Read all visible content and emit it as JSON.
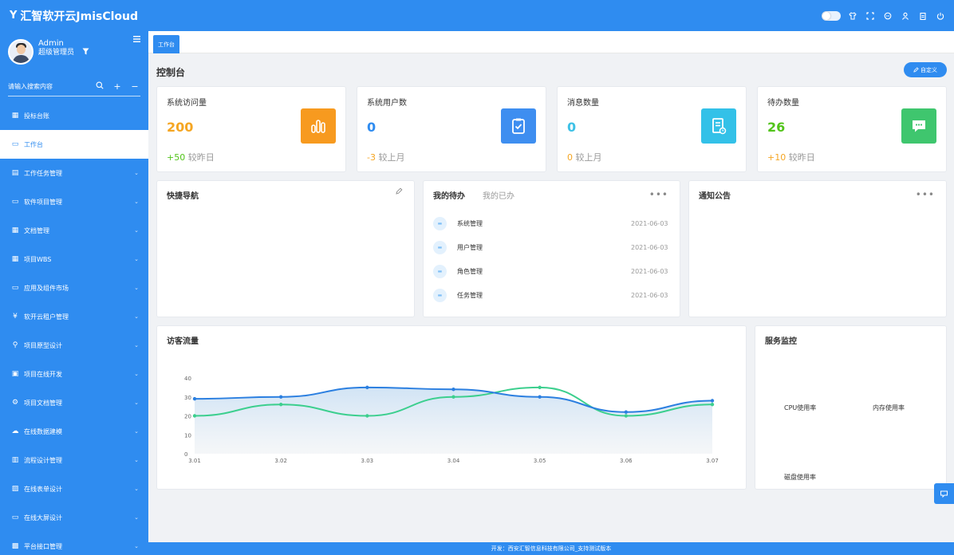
{
  "header": {
    "brand_mark": "Y",
    "brand_name": "汇智软开云JmisCloud",
    "icons": [
      "theme-toggle",
      "shirt-icon",
      "fullscreen-icon",
      "chat-icon",
      "user-icon",
      "clipboard-icon",
      "power-icon"
    ]
  },
  "sidebar": {
    "user_name": "Admin",
    "user_role": "超级管理员",
    "search_placeholder": "请输入搜索内容",
    "items": [
      {
        "label": "投标台账",
        "icon": "grid-icon",
        "chevron": false
      },
      {
        "label": "工作台",
        "icon": "monitor-icon",
        "chevron": false,
        "active": true
      },
      {
        "label": "工作任务管理",
        "icon": "clipboard-icon",
        "chevron": true
      },
      {
        "label": "软件项目管理",
        "icon": "monitor-icon",
        "chevron": true
      },
      {
        "label": "文档管理",
        "icon": "grid-icon",
        "chevron": true
      },
      {
        "label": "项目WBS",
        "icon": "grid-icon",
        "chevron": true
      },
      {
        "label": "应用及组件市场",
        "icon": "monitor-icon",
        "chevron": true
      },
      {
        "label": "软开云租户管理",
        "icon": "yen-icon",
        "chevron": true
      },
      {
        "label": "项目原型设计",
        "icon": "link-icon",
        "chevron": true
      },
      {
        "label": "项目在线开发",
        "icon": "doc-icon",
        "chevron": true
      },
      {
        "label": "项目文档管理",
        "icon": "settings-icon",
        "chevron": true
      },
      {
        "label": "在线数据建模",
        "icon": "cloud-icon",
        "chevron": true
      },
      {
        "label": "流程设计管理",
        "icon": "flow-icon",
        "chevron": true
      },
      {
        "label": "在线表单设计",
        "icon": "form-icon",
        "chevron": true
      },
      {
        "label": "在线大屏设计",
        "icon": "screen-icon",
        "chevron": true
      },
      {
        "label": "平台接口管理",
        "icon": "api-icon",
        "chevron": true
      }
    ]
  },
  "tabs": [
    {
      "label": "工作台"
    }
  ],
  "main": {
    "title": "控制台",
    "custom_button": "自定义"
  },
  "stats": [
    {
      "label": "系统访问量",
      "value": "200",
      "value_color": "#f5a623",
      "delta": "+50",
      "delta_color": "#52c41a",
      "delta_text": "较昨日",
      "icon": "bar-chart-icon",
      "icon_bg": "#f79a1f"
    },
    {
      "label": "系统用户数",
      "value": "0",
      "value_color": "#2f8cf0",
      "delta": "-3",
      "delta_color": "#f5a623",
      "delta_text": "较上月",
      "icon": "check-list-icon",
      "icon_bg": "#3e8ef0"
    },
    {
      "label": "消息数量",
      "value": "0",
      "value_color": "#3ec1e6",
      "delta": "0",
      "delta_color": "#f5a623",
      "delta_text": "较上月",
      "icon": "message-doc-icon",
      "icon_bg": "#33c1e8"
    },
    {
      "label": "待办数量",
      "value": "26",
      "value_color": "#52c41a",
      "delta": "+10",
      "delta_color": "#f5a623",
      "delta_text": "较昨日",
      "icon": "chat-bubble-icon",
      "icon_bg": "#3fc66e"
    }
  ],
  "quick_nav": {
    "title": "快捷导航"
  },
  "todo": {
    "tab_active": "我的待办",
    "tab_other": "我的已办",
    "items": [
      {
        "name": "系统管理",
        "date": "2021-06-03"
      },
      {
        "name": "用户管理",
        "date": "2021-06-03"
      },
      {
        "name": "角色管理",
        "date": "2021-06-03"
      },
      {
        "name": "任务管理",
        "date": "2021-06-03"
      }
    ]
  },
  "notice": {
    "title": "通知公告"
  },
  "visitor_chart": {
    "title": "访客流量"
  },
  "chart_data": {
    "type": "area",
    "title": "访客流量",
    "categories": [
      "3.01",
      "3.02",
      "3.03",
      "3.04",
      "3.05",
      "3.06",
      "3.07"
    ],
    "yticks": [
      0,
      10,
      20,
      30,
      40
    ],
    "ylim": [
      0,
      40
    ],
    "series": [
      {
        "values": [
          29,
          30,
          35,
          34,
          30,
          22,
          28
        ],
        "color": "#2b7fe0"
      },
      {
        "values": [
          20,
          26,
          20,
          30,
          35,
          20,
          26
        ],
        "color": "#3ccf8e"
      }
    ],
    "grid": false
  },
  "monitor": {
    "title": "服务监控",
    "cpu_label": "CPU使用率",
    "mem_label": "内存使用率",
    "disk_label": "磁盘使用率"
  },
  "footer": {
    "text": "开发：西安汇智信息科技有限公司_支持测试版本"
  }
}
